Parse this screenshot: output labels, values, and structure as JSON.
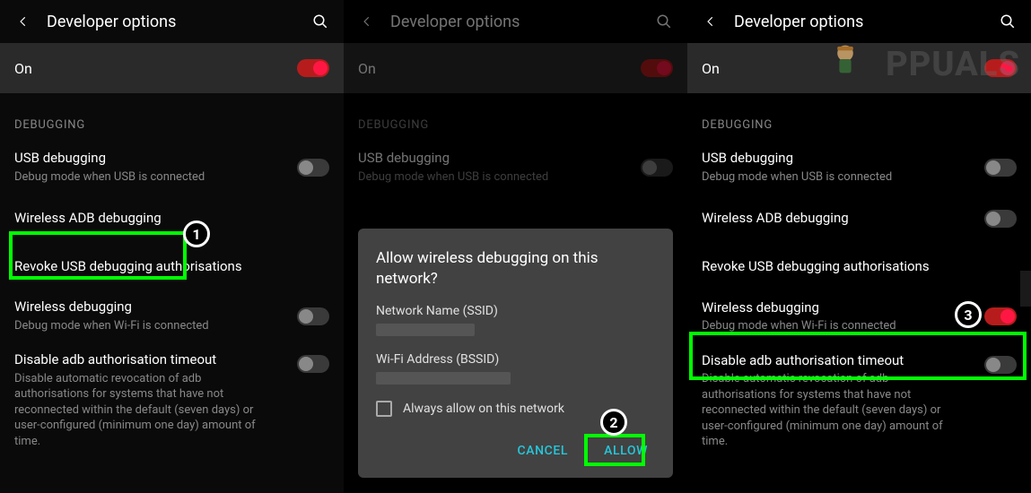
{
  "header": {
    "title": "Developer options"
  },
  "on_row": {
    "label": "On"
  },
  "section": {
    "debugging": "DEBUGGING"
  },
  "items": {
    "usb": {
      "title": "USB debugging",
      "sub": "Debug mode when USB is connected"
    },
    "wireless_adb": {
      "title": "Wireless ADB debugging"
    },
    "revoke": {
      "title": "Revoke USB debugging authorisations"
    },
    "wireless": {
      "title": "Wireless debugging",
      "sub": "Debug mode when Wi-Fi is connected"
    },
    "disable_adb": {
      "title": "Disable adb authorisation timeout",
      "sub": "Disable automatic revocation of adb authorisations for systems that have not reconnected within the default (seven days) or user-configured (minimum one day) amount of time."
    }
  },
  "dialog": {
    "title": "Allow wireless debugging on this network?",
    "ssid_label": "Network Name (SSID)",
    "bssid_label": "Wi-Fi Address (BSSID)",
    "always": "Always allow on this network",
    "cancel": "CANCEL",
    "allow": "ALLOW"
  },
  "badges": {
    "b1": "1",
    "b2": "2",
    "b3": "3"
  },
  "watermark": {
    "text": "PPUALS"
  }
}
